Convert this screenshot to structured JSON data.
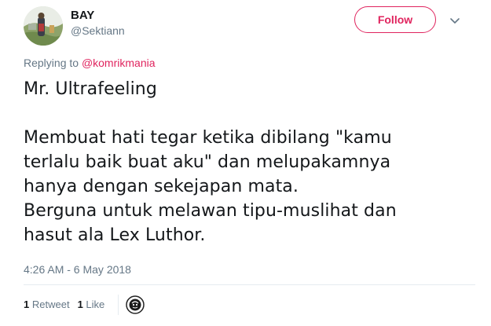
{
  "author": {
    "display_name": "BAY",
    "handle": "@Sektiann",
    "avatar": "user-avatar"
  },
  "follow_button": {
    "label": "Follow"
  },
  "more_menu": {
    "icon": "chevron-down-icon"
  },
  "reply": {
    "prefix": "Replying to",
    "mention": "@komrikmania"
  },
  "tweet": {
    "text": "Mr. Ultrafeeling\n\nMembuat hati tegar ketika dibilang \"kamu\nterlalu baik buat aku\" dan melupakamnya\nhanya dengan sekejapan mata.\nBerguna untuk melawan tipu-muslihat dan\nhasut ala Lex Luthor.",
    "timestamp": "4:26 AM - 6 May 2018"
  },
  "stats": {
    "retweet_count": "1",
    "retweet_label": "Retweet",
    "like_count": "1",
    "like_label": "Like"
  },
  "colors": {
    "accent": "#e0245e",
    "secondary_text": "#657786",
    "primary_text": "#14171a",
    "divider": "#e6ecf0"
  }
}
